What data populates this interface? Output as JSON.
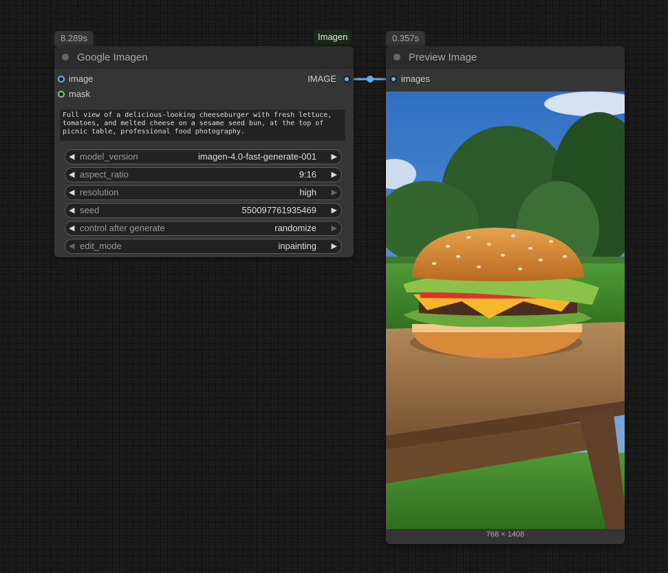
{
  "imagen_node": {
    "time_badge": "8.289s",
    "group_tag": "Imagen",
    "title": "Google Imagen",
    "inputs": [
      {
        "label": "image",
        "color": "#64b5f6"
      },
      {
        "label": "mask",
        "color": "#81c784"
      }
    ],
    "output": {
      "label": "IMAGE",
      "color": "#64b5f6"
    },
    "prompt": "Full view of a delicious-looking cheeseburger with fresh lettuce,\ntomatoes, and melted cheese on a sesame seed bun, at the top of\npicnic table, professional food photography.",
    "widgets": [
      {
        "label": "model_version",
        "value": "imagen-4.0-fast-generate-001"
      },
      {
        "label": "aspect_ratio",
        "value": "9:16"
      },
      {
        "label": "resolution",
        "value": "high"
      },
      {
        "label": "seed",
        "value": "550097761935469"
      },
      {
        "label": "control after generate",
        "value": "randomize"
      },
      {
        "label": "edit_mode",
        "value": "inpainting"
      }
    ]
  },
  "preview_node": {
    "time_badge": "0.357s",
    "title": "Preview Image",
    "input": {
      "label": "images",
      "color": "#64b5f6"
    },
    "image_caption": "768 × 1408"
  }
}
